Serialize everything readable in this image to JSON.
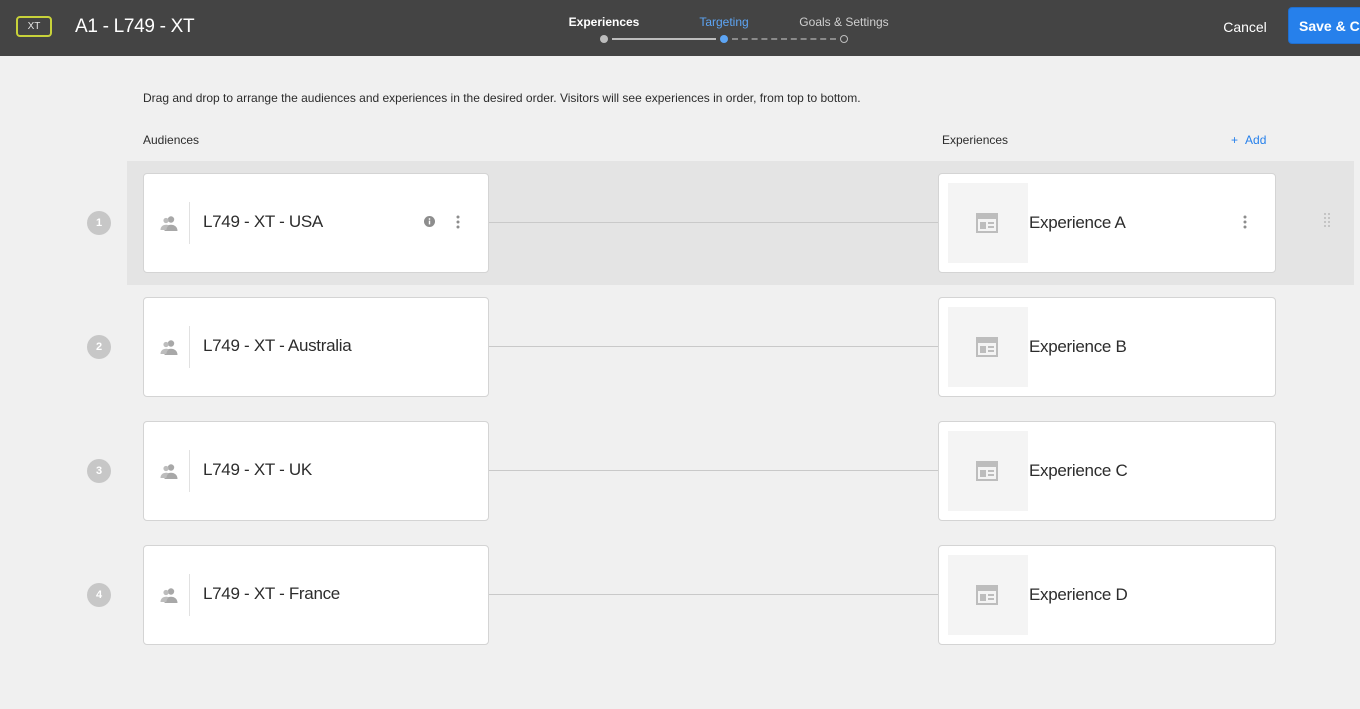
{
  "header": {
    "badge": "XT",
    "title": "A1 - L749 - XT",
    "steps": [
      {
        "label": "Experiences",
        "state": "done"
      },
      {
        "label": "Targeting",
        "state": "active"
      },
      {
        "label": "Goals & Settings",
        "state": "pending"
      }
    ],
    "cancel_label": "Cancel",
    "save_label": "Save & Close"
  },
  "main": {
    "instructions": "Drag and drop to arrange the audiences and experiences in the desired order. Visitors will see experiences in order, from top to bottom.",
    "audiences_header": "Audiences",
    "experiences_header": "Experiences",
    "add_plus": "+",
    "add_label": "Add"
  },
  "rows": [
    {
      "number": "1",
      "audience": "L749 - XT - USA",
      "experience": "Experience A"
    },
    {
      "number": "2",
      "audience": "L749 - XT - Australia",
      "experience": "Experience B"
    },
    {
      "number": "3",
      "audience": "L749 - XT - UK",
      "experience": "Experience C"
    },
    {
      "number": "4",
      "audience": "L749 - XT - France",
      "experience": "Experience D"
    }
  ],
  "colors": {
    "header_bg": "#444444",
    "accent_blue": "#2680eb",
    "active_step": "#5da5f5",
    "badge_border": "#c8d23a",
    "page_bg": "#f0f0f0"
  },
  "icons": {
    "audience": "audience-people-icon",
    "info": "info-icon",
    "more": "more-vertical-icon",
    "experience": "experience-layout-icon",
    "drag": "drag-handle-icon"
  }
}
